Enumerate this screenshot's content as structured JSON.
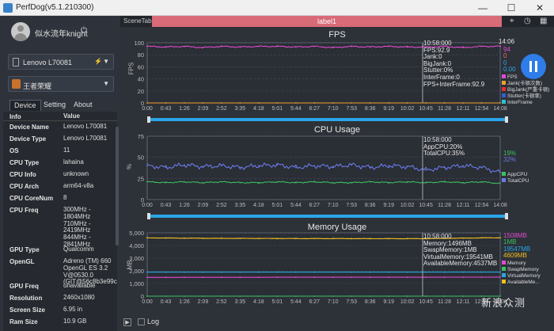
{
  "window": {
    "title": "PerfDog(v5.1.210300)",
    "minimize": "—",
    "maximize": "☐",
    "close": "✕"
  },
  "user": {
    "name": "似水流年knight",
    "power_icon": "⏻"
  },
  "device_select": {
    "label": "Lenovo L70081"
  },
  "app_select": {
    "label": "王者荣耀"
  },
  "tabs": [
    {
      "label": "Device"
    },
    {
      "label": "Setting"
    },
    {
      "label": "About"
    }
  ],
  "info_table": {
    "headers": [
      "Info",
      "Value"
    ],
    "rows": [
      {
        "k": "Device Name",
        "v": "Lenovo L70081"
      },
      {
        "k": "Device Type",
        "v": "Lenovo L70081"
      },
      {
        "k": "OS",
        "v": "11"
      },
      {
        "k": "CPU Type",
        "v": "lahaina"
      },
      {
        "k": "CPU Info",
        "v": "unknown"
      },
      {
        "k": "CPU Arch",
        "v": "arm64-v8a"
      },
      {
        "k": "CPU CoreNum",
        "v": "8"
      },
      {
        "k": "CPU Freq",
        "v": "300MHz - 1804MHz\n710MHz - 2419MHz\n844MHz - 2841MHz"
      },
      {
        "k": "GPU Type",
        "v": "Qualcomm"
      },
      {
        "k": "OpenGL",
        "v": "Adreno (TM) 660\nOpenGL ES 3.2\nV@0530.0\n(GIT@56c8b3e99c"
      },
      {
        "k": "GPU Freq",
        "v": "unavailable"
      },
      {
        "k": "Resolution",
        "v": "2460x1080"
      },
      {
        "k": "Screen Size",
        "v": "6.95 in"
      },
      {
        "k": "Ram Size",
        "v": "10.9 GB"
      }
    ]
  },
  "topbar": {
    "scene_tab": "SceneTab",
    "label": "label1"
  },
  "x_ticks": [
    "0:00",
    "0:43",
    "1:26",
    "2:09",
    "2:52",
    "3:35",
    "4:18",
    "5:01",
    "5:44",
    "6:27",
    "7:10",
    "7:53",
    "8:36",
    "9:19",
    "10:02",
    "10:45",
    "11:28",
    "12:11",
    "12:54",
    "14:08"
  ],
  "fps": {
    "title": "FPS",
    "ylabel": "FPS",
    "end_time": "14:06",
    "annotation": [
      "10:58:000",
      "FPS:92.9",
      "Jank:0",
      "BigJank:0",
      "Stutter:0%",
      "InterFrame:0",
      "FPS+InterFrame:92.9"
    ],
    "side_values": [
      {
        "t": "94",
        "c": "#e04bd0"
      },
      {
        "t": "0",
        "c": "#f06a6a"
      },
      {
        "t": "0",
        "c": "#2aa6e8"
      },
      {
        "t": "0.00",
        "c": "#2aa6e8"
      }
    ],
    "legend": [
      {
        "t": "FPS",
        "c": "#e04bd0"
      },
      {
        "t": "Jank(卡顿次数)",
        "c": "#f0a030"
      },
      {
        "t": "BigJank(严重卡顿)",
        "c": "#e03030"
      },
      {
        "t": "Stutter(卡顿率)",
        "c": "#3060d0"
      },
      {
        "t": "InterFrame",
        "c": "#30c0d0"
      }
    ]
  },
  "cpu": {
    "title": "CPU Usage",
    "ylabel": "%",
    "annotation": [
      "10:58:000",
      "AppCPU:20%",
      "TotalCPU:35%"
    ],
    "side_values": [
      {
        "t": "19%",
        "c": "#3cc060"
      },
      {
        "t": "32%",
        "c": "#6a7ae8"
      }
    ],
    "legend": [
      {
        "t": "AppCPU",
        "c": "#3cc060"
      },
      {
        "t": "TotalCPU",
        "c": "#6a7ae8"
      }
    ]
  },
  "mem": {
    "title": "Memory Usage",
    "ylabel": "MB",
    "annotation": [
      "10:58:000",
      "Memory:1496MB",
      "SwapMemory:1MB",
      "VirtualMemory:19541MB",
      "AvailableMemory:4537MB"
    ],
    "side_values": [
      {
        "t": "1508MB",
        "c": "#e04bd0"
      },
      {
        "t": "1MB",
        "c": "#3cc060"
      },
      {
        "t": "19547MB",
        "c": "#2aa6e8"
      },
      {
        "t": "4609MB",
        "c": "#f0c020"
      }
    ],
    "legend": [
      {
        "t": "Memory",
        "c": "#e04bd0"
      },
      {
        "t": "SwapMemory",
        "c": "#3cc060"
      },
      {
        "t": "VirtualMemory",
        "c": "#2aa6e8"
      },
      {
        "t": "AvailableMe...",
        "c": "#f0c020"
      }
    ]
  },
  "bottom": {
    "log": "Log"
  },
  "watermark": "新浪众测",
  "chart_data": [
    {
      "type": "line",
      "title": "FPS",
      "ylabel": "FPS",
      "ylim": [
        0,
        100
      ],
      "yticks": [
        0,
        20,
        40,
        60,
        80,
        100
      ],
      "x": [
        "0:00",
        "0:43",
        "1:26",
        "2:09",
        "2:52",
        "3:35",
        "4:18",
        "5:01",
        "5:44",
        "6:27",
        "7:10",
        "7:53",
        "8:36",
        "9:19",
        "10:02",
        "10:45",
        "11:28",
        "12:11",
        "12:54",
        "14:08"
      ],
      "series": [
        {
          "name": "FPS",
          "values": [
            94,
            93,
            94,
            92,
            94,
            93,
            94,
            94,
            93,
            94,
            92,
            94,
            93,
            94,
            93,
            93,
            94,
            92,
            94,
            94
          ]
        },
        {
          "name": "Jank",
          "values": [
            0,
            0,
            0,
            0,
            0,
            0,
            0,
            0,
            0,
            0,
            0,
            0,
            0,
            0,
            0,
            0,
            0,
            0,
            0,
            0
          ]
        }
      ]
    },
    {
      "type": "line",
      "title": "CPU Usage",
      "ylabel": "%",
      "ylim": [
        0,
        75
      ],
      "yticks": [
        0,
        25,
        50,
        75
      ],
      "x": [
        "0:00",
        "0:43",
        "1:26",
        "2:09",
        "2:52",
        "3:35",
        "4:18",
        "5:01",
        "5:44",
        "6:27",
        "7:10",
        "7:53",
        "8:36",
        "9:19",
        "10:02",
        "10:45",
        "11:28",
        "12:11",
        "12:54",
        "14:08"
      ],
      "series": [
        {
          "name": "AppCPU",
          "values": [
            21,
            20,
            21,
            20,
            21,
            20,
            20,
            21,
            20,
            21,
            20,
            20,
            21,
            20,
            21,
            20,
            21,
            20,
            21,
            19
          ]
        },
        {
          "name": "TotalCPU",
          "values": [
            40,
            38,
            41,
            39,
            40,
            38,
            40,
            41,
            38,
            40,
            39,
            41,
            38,
            40,
            39,
            35,
            38,
            40,
            38,
            32
          ]
        }
      ]
    },
    {
      "type": "line",
      "title": "Memory Usage",
      "ylabel": "MB",
      "ylim": [
        0,
        5000
      ],
      "yticks": [
        0,
        1000,
        2000,
        3000,
        4000,
        5000
      ],
      "x": [
        "0:00",
        "0:43",
        "1:26",
        "2:09",
        "2:52",
        "3:35",
        "4:18",
        "5:01",
        "5:44",
        "6:27",
        "7:10",
        "7:53",
        "8:36",
        "9:19",
        "10:02",
        "10:45",
        "11:28",
        "12:11",
        "12:54",
        "14:08"
      ],
      "series": [
        {
          "name": "Memory",
          "values": [
            1480,
            1482,
            1485,
            1486,
            1488,
            1489,
            1490,
            1491,
            1492,
            1493,
            1494,
            1494,
            1495,
            1495,
            1496,
            1496,
            1497,
            1498,
            1500,
            1508
          ]
        },
        {
          "name": "SwapMemory",
          "values": [
            1,
            1,
            1,
            1,
            1,
            1,
            1,
            1,
            1,
            1,
            1,
            1,
            1,
            1,
            1,
            1,
            1,
            1,
            1,
            1
          ]
        },
        {
          "name": "AvailableMemory",
          "values": [
            4600,
            4590,
            4580,
            4570,
            4565,
            4560,
            4555,
            4550,
            4548,
            4545,
            4543,
            4542,
            4540,
            4539,
            4538,
            4537,
            4560,
            4580,
            4600,
            4609
          ]
        },
        {
          "name": "VirtualMemory",
          "values": [
            1900,
            1900,
            1900,
            1900,
            1900,
            1900,
            1900,
            1900,
            1900,
            1900,
            1900,
            1900,
            1900,
            1900,
            1900,
            1900,
            1900,
            1900,
            1900,
            1900
          ]
        }
      ]
    }
  ]
}
